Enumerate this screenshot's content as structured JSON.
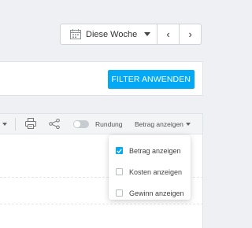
{
  "week": {
    "label": "Diese Woche",
    "prev": "‹",
    "next": "›"
  },
  "filter": {
    "button_label": "FILTER ANWENDEN"
  },
  "toolbar": {
    "rundung_label": "Rundung",
    "rundung_on": false,
    "display_label": "Betrag anzeigen"
  },
  "dropdown": {
    "items": [
      {
        "label": "Betrag anzeigen",
        "checked": true
      },
      {
        "label": "Kosten anzeigen",
        "checked": false
      },
      {
        "label": "Gewinn anzeigen",
        "checked": false
      }
    ]
  },
  "colors": {
    "accent": "#03a9f4",
    "background": "#eef0f3"
  }
}
